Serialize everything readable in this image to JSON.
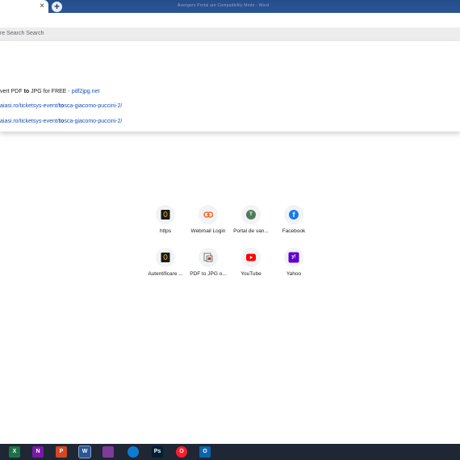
{
  "browser": {
    "tab_close": "×",
    "new_tab": "+",
    "window_title": "Avengers Portal are Compatibility Mode  -  Word"
  },
  "omnibox": {
    "text": "re Search Search"
  },
  "suggestions": [
    {
      "pre": "vert PDF ",
      "bold": "to",
      "post": " JPG for FREE",
      "sep": " - ",
      "source": "pdf2jpg.net"
    },
    {
      "pre": "aiasi.ro/ticketsys-event/",
      "bold": "to",
      "post": "sca-giacomo-puccini-2/"
    },
    {
      "pre": "aiasi.ro/ticketsys-event/",
      "bold": "to",
      "post": "sca-giacomo-puccini-2/"
    }
  ],
  "shortcuts": [
    {
      "label": "https",
      "icon": "opera-house-icon"
    },
    {
      "label": "Webmail Login",
      "icon": "cpanel-icon"
    },
    {
      "label": "Portal de van...",
      "icon": "portal-t-icon",
      "letter": "T"
    },
    {
      "label": "Facebook",
      "icon": "facebook-icon",
      "letter": "f"
    },
    {
      "label": "Autentificare ...",
      "icon": "opera-house-icon"
    },
    {
      "label": "PDF to JPG o...",
      "icon": "pdf-to-jpg-icon"
    },
    {
      "label": "YouTube",
      "icon": "youtube-icon"
    },
    {
      "label": "Yahoo",
      "icon": "yahoo-icon",
      "letter": "y!"
    }
  ],
  "taskbar": [
    {
      "name": "excel-icon",
      "letter": "X",
      "color": "#1e7145"
    },
    {
      "name": "onenote-icon",
      "letter": "N",
      "color": "#7719aa"
    },
    {
      "name": "powerpoint-icon",
      "letter": "P",
      "color": "#d24726"
    },
    {
      "name": "word-icon",
      "letter": "W",
      "color": "#2b5797"
    },
    {
      "name": "winrar-icon",
      "letter": "",
      "color": "#7d3c98"
    },
    {
      "name": "edge-icon",
      "letter": "",
      "color": "#0f7bd0"
    },
    {
      "name": "photoshop-icon",
      "letter": "Ps",
      "color": "#001e36"
    },
    {
      "name": "opera-icon",
      "letter": "O",
      "color": "#ff1b2d"
    },
    {
      "name": "outlook-icon",
      "letter": "O",
      "color": "#0a64ad"
    }
  ]
}
